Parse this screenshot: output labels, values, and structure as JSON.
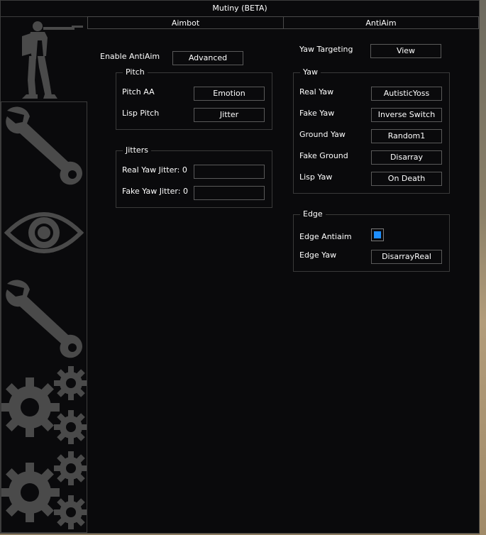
{
  "window": {
    "title": "Mutiny (BETA)"
  },
  "tabs": [
    {
      "label": "Aimbot"
    },
    {
      "label": "AntiAim"
    }
  ],
  "sidebar": {
    "items": [
      {
        "icon": "soldier-icon"
      },
      {
        "icon": "wrench-icon"
      },
      {
        "icon": "eye-icon"
      },
      {
        "icon": "wrench-icon"
      },
      {
        "icon": "gears-icon"
      },
      {
        "icon": "gears-icon"
      }
    ]
  },
  "antiaim": {
    "enable_label": "Enable AntiAim",
    "enable_value": "Advanced",
    "yaw_targeting_label": "Yaw Targeting",
    "yaw_targeting_value": "View",
    "pitch": {
      "title": "Pitch",
      "pitch_aa_label": "Pitch AA",
      "pitch_aa_value": "Emotion",
      "lisp_pitch_label": "Lisp Pitch",
      "lisp_pitch_value": "Jitter"
    },
    "jitters": {
      "title": "Jitters",
      "real_label": "Real Yaw Jitter: 0",
      "fake_label": "Fake Yaw Jitter: 0",
      "real_value": "",
      "fake_value": ""
    },
    "yaw": {
      "title": "Yaw",
      "real_yaw_label": "Real Yaw",
      "real_yaw_value": "AutisticYoss",
      "fake_yaw_label": "Fake Yaw",
      "fake_yaw_value": "Inverse Switch",
      "ground_yaw_label": "Ground Yaw",
      "ground_yaw_value": "Random1",
      "fake_ground_label": "Fake Ground",
      "fake_ground_value": "Disarray",
      "lisp_yaw_label": "Lisp Yaw",
      "lisp_yaw_value": "On Death"
    },
    "edge": {
      "title": "Edge",
      "edge_antiaim_label": "Edge Antiaim",
      "edge_antiaim_checked": true,
      "edge_yaw_label": "Edge Yaw",
      "edge_yaw_value": "DisarrayReal"
    }
  },
  "colors": {
    "accent": "#1e8fff",
    "background": "#0a0a0c",
    "border": "#3c3c3c",
    "icon": "#4a4a4a"
  }
}
